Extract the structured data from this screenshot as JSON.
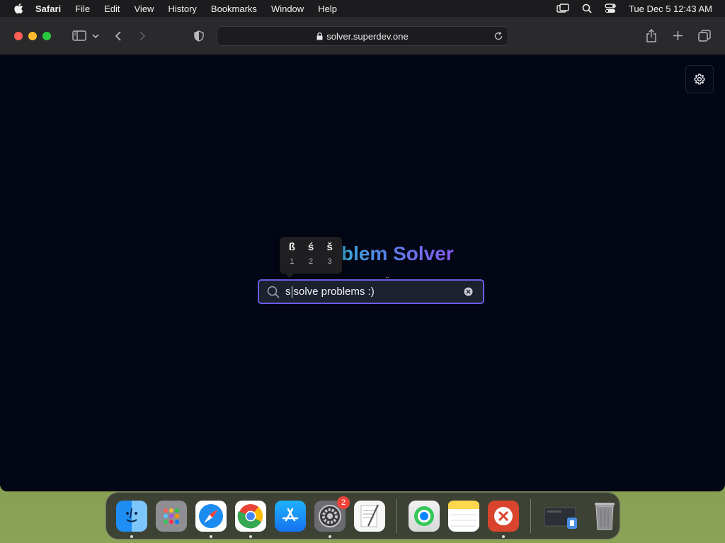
{
  "menubar": {
    "app_name": "Safari",
    "items": [
      "File",
      "Edit",
      "View",
      "History",
      "Bookmarks",
      "Window",
      "Help"
    ],
    "clock": "Tue Dec 5  12:43 AM",
    "status_icons": [
      "screen-mirroring-icon",
      "spotlight-search-icon",
      "control-center-icon"
    ]
  },
  "browser": {
    "url": "solver.superdev.one"
  },
  "page": {
    "headline": "blem Solver",
    "subline_fragment": "..",
    "search": {
      "typed": "s",
      "rest": "solve problems :)"
    },
    "accent_popup": {
      "options": [
        {
          "glyph": "ß",
          "key": "1"
        },
        {
          "glyph": "ś",
          "key": "2"
        },
        {
          "glyph": "š",
          "key": "3"
        }
      ]
    },
    "colors": {
      "page_bg": "#030614",
      "search_border": "#6d5ce8",
      "headline_gradient_start": "#3aa9d6",
      "headline_gradient_end": "#8b5cf6"
    }
  },
  "dock": {
    "apps": [
      {
        "name": "Finder",
        "icon": "finder-icon",
        "running": true
      },
      {
        "name": "Launchpad",
        "icon": "launchpad-icon",
        "running": false
      },
      {
        "name": "Safari",
        "icon": "safari-icon",
        "running": true
      },
      {
        "name": "Google Chrome",
        "icon": "chrome-icon",
        "running": true
      },
      {
        "name": "App Store",
        "icon": "app-store-icon",
        "running": false
      },
      {
        "name": "System Settings",
        "icon": "system-settings-icon",
        "running": true,
        "badge": "2"
      },
      {
        "name": "TextEdit",
        "icon": "textedit-icon",
        "running": false
      },
      {
        "name": "Find My",
        "icon": "find-my-icon",
        "running": false
      },
      {
        "name": "Notes",
        "icon": "notes-icon",
        "running": false
      },
      {
        "name": "Remote Desktop",
        "icon": "remote-desktop-icon",
        "running": true
      },
      {
        "name": "Downloads",
        "icon": "downloads-stack-icon",
        "running": false
      },
      {
        "name": "Trash",
        "icon": "trash-icon",
        "running": false
      }
    ]
  }
}
